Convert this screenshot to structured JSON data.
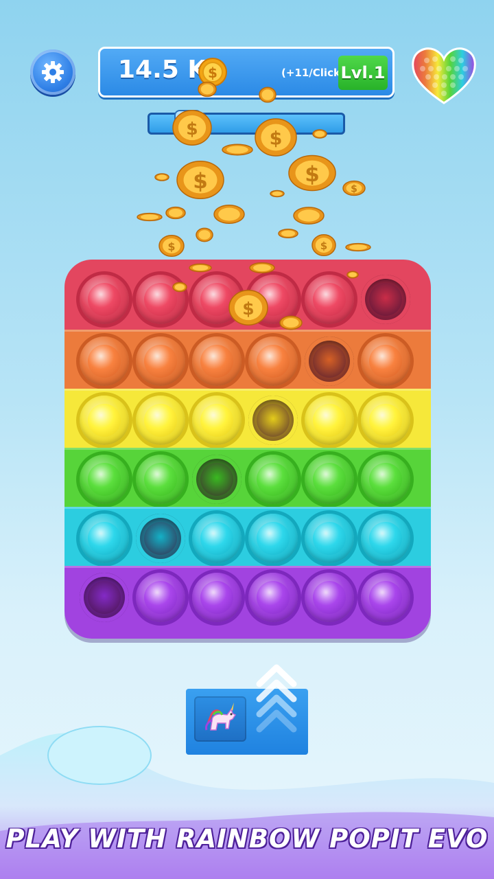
{
  "hud": {
    "score": "14.5 K",
    "per_click": "(+11/Click)",
    "level": "Lvl.1"
  },
  "progress": {
    "value": 0.15
  },
  "icons": {
    "settings": "gear-icon",
    "currency": "coin-icon",
    "skin": "rainbow-heart-icon",
    "upgrade": "unicorn-icon",
    "upgrade_arrows": "chevron-up-icon"
  },
  "popit": {
    "rows": [
      {
        "color": "#e3465f",
        "dark": "#c02b45",
        "popped": [
          5
        ]
      },
      {
        "color": "#ec7b3c",
        "dark": "#cc5c24",
        "popped": [
          4
        ]
      },
      {
        "color": "#f6e83a",
        "dark": "#d9c21a",
        "popped": [
          3
        ]
      },
      {
        "color": "#57d43a",
        "dark": "#37b01f",
        "popped": [
          2
        ]
      },
      {
        "color": "#2ccde0",
        "dark": "#13a8bd",
        "popped": [
          1
        ]
      },
      {
        "color": "#a143e0",
        "dark": "#7d28bd",
        "popped": [
          0
        ]
      }
    ]
  },
  "colors": {
    "accent_blue": "#2b8ae6",
    "level_green": "#28b229",
    "tagline_outline": "#4b1f96"
  },
  "tagline": "PLAY WITH RAINBOW POPIT EVO"
}
